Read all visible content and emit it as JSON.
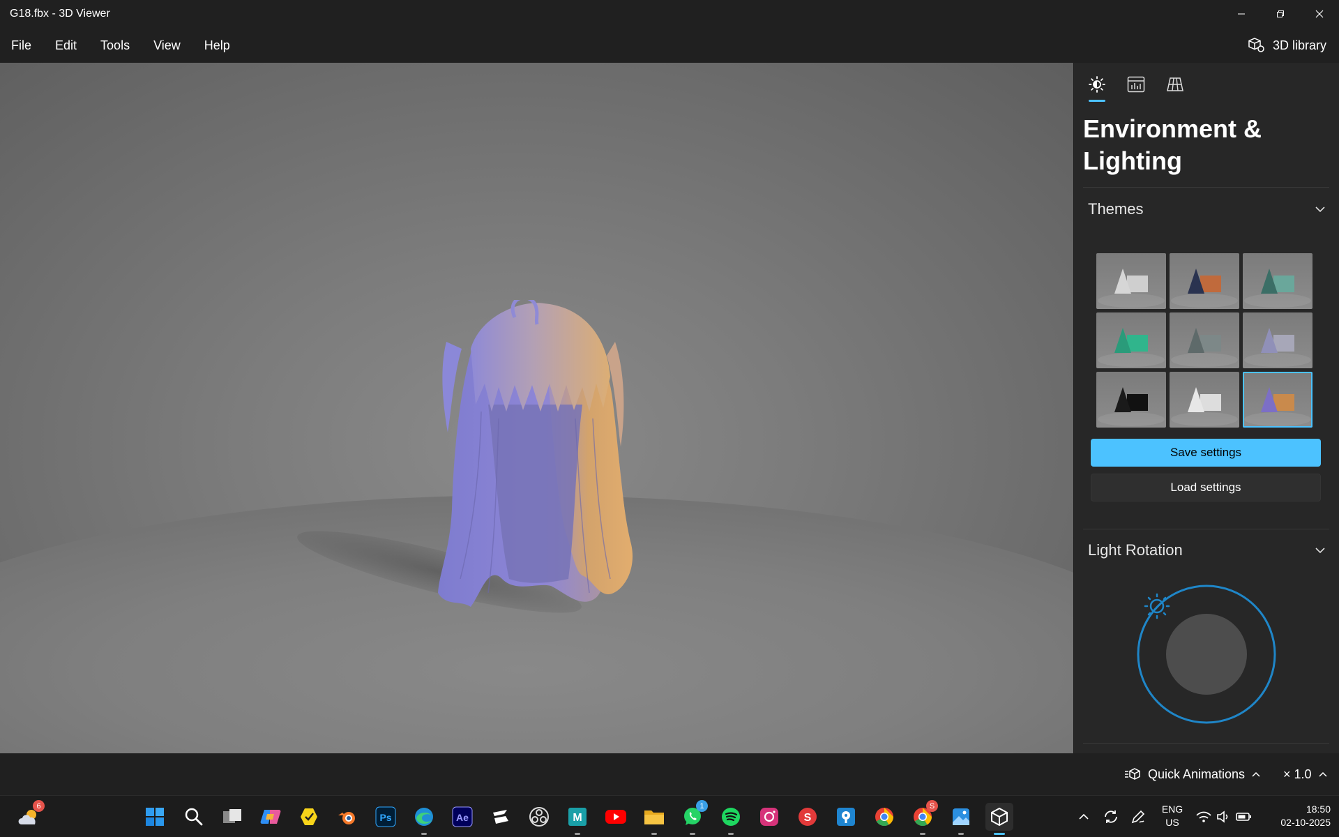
{
  "window": {
    "title": "G18.fbx - 3D Viewer"
  },
  "menu": {
    "items": [
      "File",
      "Edit",
      "Tools",
      "View",
      "Help"
    ],
    "library_label": "3D library"
  },
  "panel": {
    "title": "Environment & Lighting",
    "tabs": [
      "lighting-tab",
      "stats-tab",
      "grid-tab"
    ],
    "themes_label": "Themes",
    "themes": [
      {
        "name": "white",
        "shape": "#d6d6d6",
        "box": "#cfcfcf"
      },
      {
        "name": "orange-navy",
        "shape": "#2a3350",
        "box": "#c06a3c"
      },
      {
        "name": "teal",
        "shape": "#3b6e66",
        "box": "#6aa79b"
      },
      {
        "name": "green",
        "shape": "#2a9b7a",
        "box": "#30b58c"
      },
      {
        "name": "slate",
        "shape": "#5e6a6a",
        "box": "#7d8888"
      },
      {
        "name": "lavender",
        "shape": "#9090b8",
        "box": "#a7a7b8"
      },
      {
        "name": "black",
        "shape": "#1a1a1a",
        "box": "#111111"
      },
      {
        "name": "bright-white",
        "shape": "#e7e7e7",
        "box": "#dddddd"
      },
      {
        "name": "purple-orange",
        "shape": "#7c6fc6",
        "box": "#c98a4c",
        "selected": true
      }
    ],
    "save_label": "Save settings",
    "load_label": "Load settings",
    "light_rotation_label": "Light Rotation"
  },
  "bottom": {
    "quick_animations_label": "Quick Animations",
    "speed_label": "× 1.0"
  },
  "taskbar": {
    "weather_badge": "6",
    "whatsapp_badge": "1",
    "chrome_badge": "S",
    "lang_line1": "ENG",
    "lang_line2": "US",
    "time": "18:50",
    "date": "02-10-2025"
  },
  "colors": {
    "accent": "#4cc2ff",
    "background": "#202020",
    "panel": "#272727"
  }
}
